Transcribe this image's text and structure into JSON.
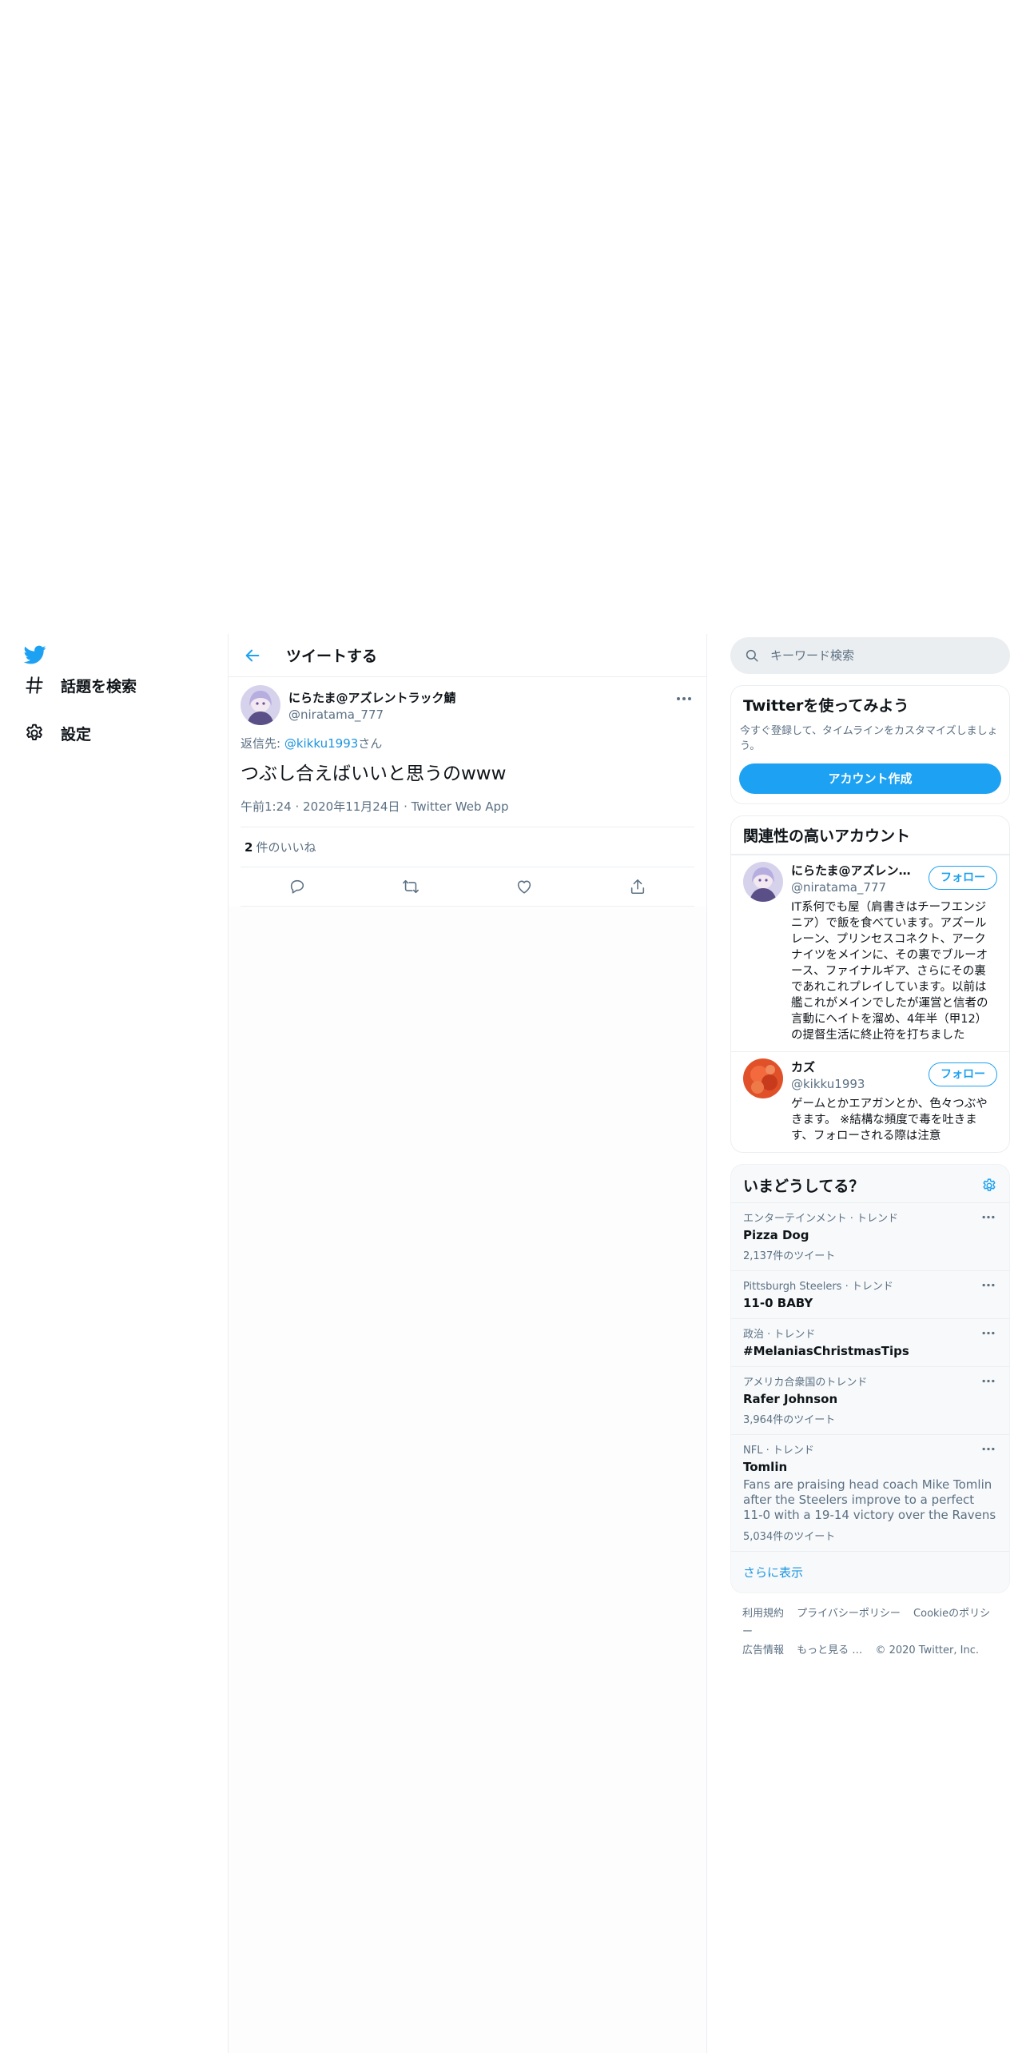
{
  "header": {
    "title": "ツイートする"
  },
  "nav": {
    "items": [
      {
        "label": "話題を検索",
        "icon": "hashtag-icon"
      },
      {
        "label": "設定",
        "icon": "gear-icon"
      }
    ]
  },
  "tweet": {
    "display_name": "にらたま@アズレントラック鯖",
    "screen_name": "@niratama_777",
    "replying_prefix": "返信先: ",
    "replying_to": "@kikku1993",
    "replying_suffix": "さん",
    "text": "つぶし合えばいいと思うのwww",
    "time": "午前1:24",
    "date": "2020年11月24日",
    "source": "Twitter Web App",
    "sep": "·",
    "like_count": "2",
    "like_label": "件のいいね"
  },
  "search": {
    "placeholder": "キーワード検索"
  },
  "signup": {
    "title": "Twitterを使ってみよう",
    "desc": "今すぐ登録して、タイムラインをカスタマイズしましょう。",
    "button": "アカウント作成"
  },
  "related": {
    "title": "関連性の高いアカウント",
    "accounts": [
      {
        "name": "にらたま@アズレントラック鯖",
        "handle": "@niratama_777",
        "follow": "フォロー",
        "bio": "IT系何でも屋（肩書きはチーフエンジニア）で飯を食べています。アズールレーン、プリンセスコネクト、アークナイツをメインに、その裏でブルーオース、ファイナルギア、さらにその裏であれこれプレイしています。以前は艦これがメインでしたが運営と信者の言動にヘイトを溜め、4年半（甲12）の提督生活に終止符を打ちました"
      },
      {
        "name": "カズ",
        "handle": "@kikku1993",
        "follow": "フォロー",
        "bio": "ゲームとかエアガンとか、色々つぶやきます。 ※結構な頻度で毒を吐きます、フォローされる際は注意"
      }
    ]
  },
  "trends": {
    "title": "いまどうしてる？",
    "items": [
      {
        "context": "エンターテインメント · トレンド",
        "name": "Pizza Dog",
        "desc": "",
        "count": "2,137件のツイート"
      },
      {
        "context": "Pittsburgh Steelers · トレンド",
        "name": "11-0 BABY",
        "desc": "",
        "count": ""
      },
      {
        "context": "政治 · トレンド",
        "name": "#MelaniasChristmasTips",
        "desc": "",
        "count": ""
      },
      {
        "context": "アメリカ合衆国のトレンド",
        "name": "Rafer Johnson",
        "desc": "",
        "count": "3,964件のツイート"
      },
      {
        "context": "NFL · トレンド",
        "name": "Tomlin",
        "desc": "Fans are praising head coach Mike Tomlin after the Steelers improve to a perfect 11-0 with a 19-14 victory over the Ravens",
        "count": "5,034件のツイート"
      }
    ],
    "show_more": "さらに表示"
  },
  "footer": {
    "links": [
      "利用規約",
      "プライバシーポリシー",
      "Cookieのポリシー",
      "広告情報",
      "もっと見る …"
    ],
    "copyright": "© 2020 Twitter, Inc."
  },
  "colors": {
    "accent": "#1da1f2",
    "link": "#1b95e0",
    "muted": "#5b7083"
  }
}
